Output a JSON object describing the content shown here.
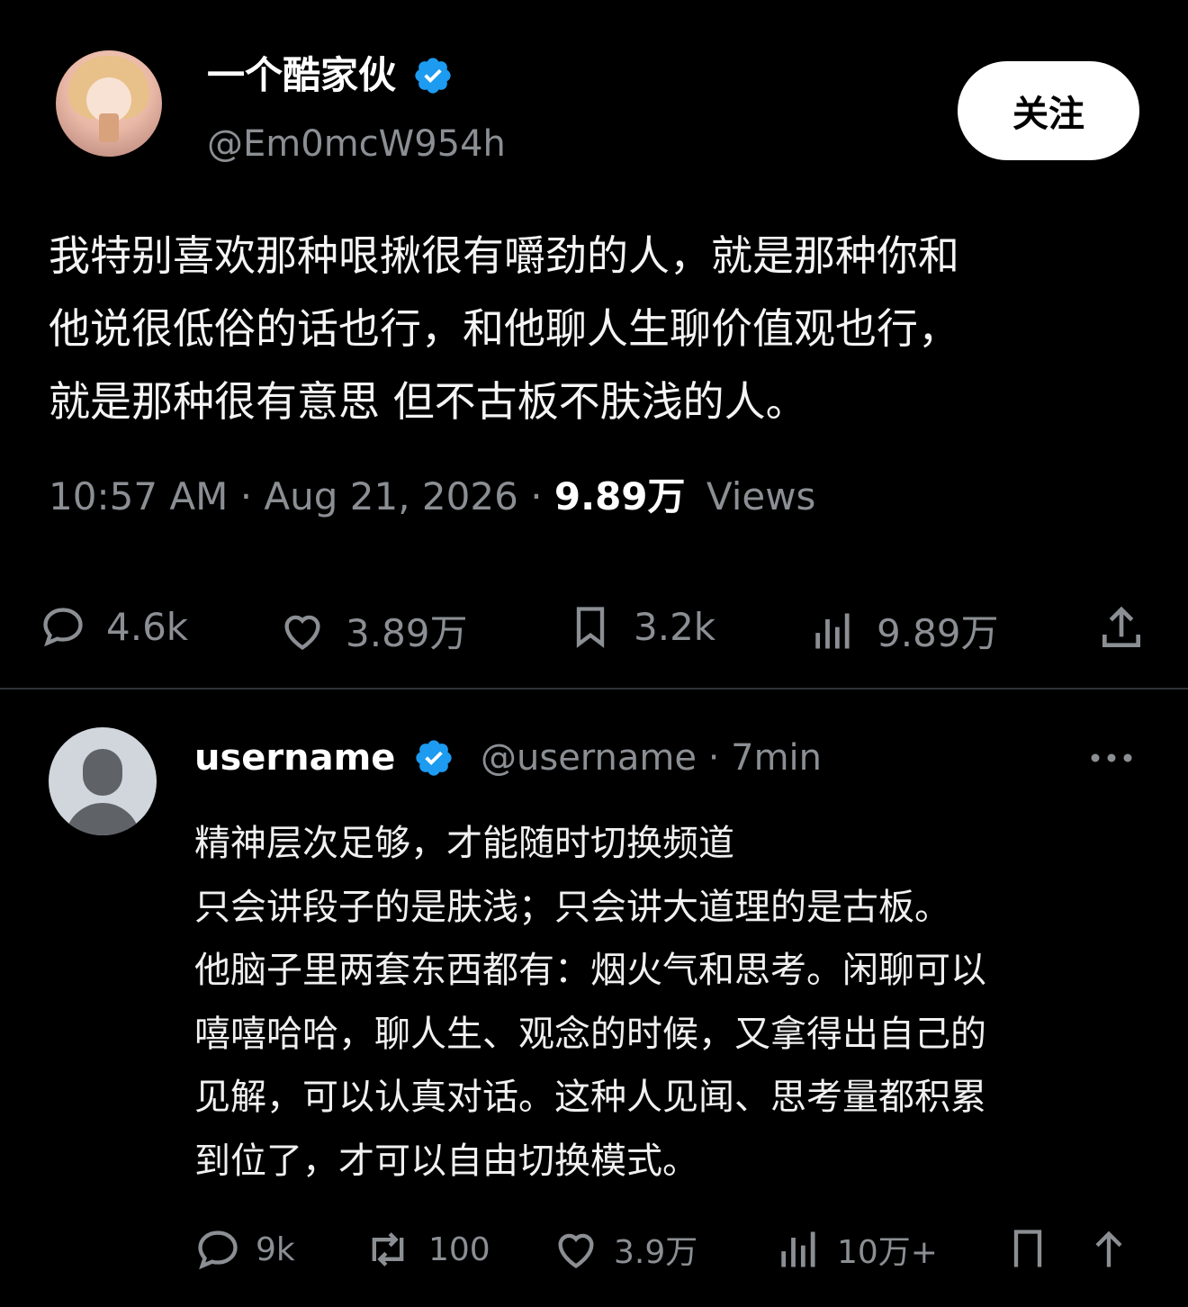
{
  "main_post": {
    "display_name": "一个酷家伙",
    "handle": "@Em0mcW954h",
    "follow_label": "关注",
    "text": "我特别喜欢那种哏揪很有嚼劲的人，就是那种你和\n他说很低俗的话也行，和他聊人生聊价值观也行，\n就是那种很有意思 但不古板不肤浅的人。",
    "time": "10:57 AM",
    "date": "Aug 21, 2026",
    "views_count": "9.89万",
    "views_label": "Views",
    "actions": {
      "replies": "4.6k",
      "likes": "3.89万",
      "bookmarks": "3.2k",
      "views": "9.89万"
    }
  },
  "reply": {
    "display_name": "username",
    "handle": "@username",
    "age": "7min",
    "text": "精神层次足够，才能随时切换频道\n只会讲段子的是肤浅；只会讲大道理的是古板。\n他脑子里两套东西都有：烟火气和思考。闲聊可以\n嘻嘻哈哈，聊人生、观念的时候，又拿得出自己的\n见解，可以认真对话。这种人见闻、思考量都积累\n到位了，才可以自由切换模式。",
    "actions": {
      "replies": "9k",
      "reposts": "100",
      "likes": "3.9万",
      "views": "10万+"
    }
  },
  "colors": {
    "background": "#000000",
    "muted_text": "#8b8f94",
    "verified_blue": "#1d9bf0",
    "divider": "#2f3336"
  },
  "icons": [
    "verified-badge-icon",
    "reply-icon",
    "heart-icon",
    "bookmark-icon",
    "views-icon",
    "share-icon",
    "repost-icon",
    "more-icon"
  ]
}
